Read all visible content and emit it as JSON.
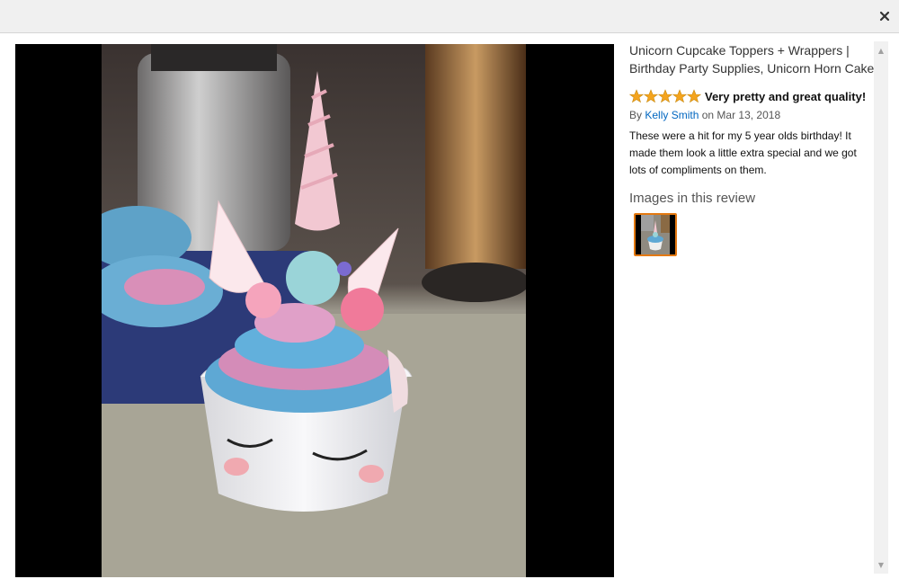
{
  "product": {
    "title_line1": "Unicorn Cupcake Toppers + Wrappers |",
    "title_line2": "Birthday Party Supplies, Unicorn Horn Cake"
  },
  "review": {
    "rating": 5,
    "rating_max": 5,
    "title": "Very pretty and great quality!",
    "by_prefix": "By",
    "author": "Kelly Smith",
    "date_text": "on Mar 13, 2018",
    "body": "These were a hit for my 5 year olds birthday! It made them look a little extra special and we got lots of compliments on them."
  },
  "images_section": {
    "heading": "Images in this review"
  },
  "icons": {
    "close": "close-icon",
    "star": "star-icon",
    "scroll_up": "scroll-up-icon",
    "scroll_down": "scroll-down-icon"
  },
  "colors": {
    "star_fill": "#f4a41e",
    "link": "#0066c0",
    "thumb_border": "#e47911",
    "topbar": "#f0f0f0"
  }
}
